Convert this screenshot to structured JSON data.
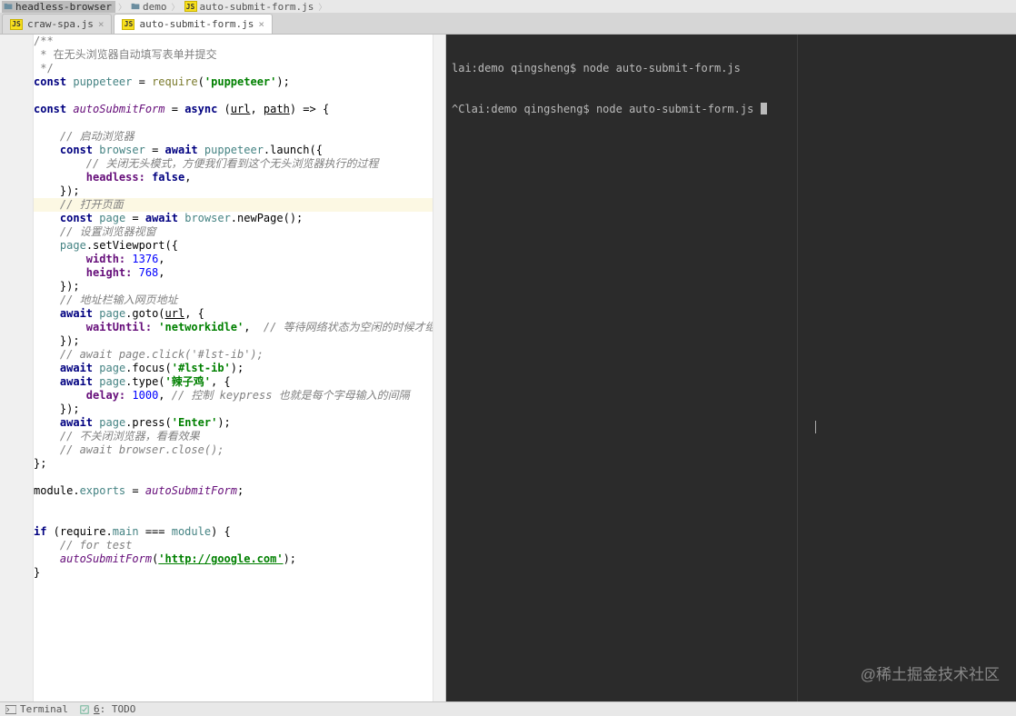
{
  "breadcrumbs": [
    {
      "type": "folder",
      "label": "headless-browser"
    },
    {
      "type": "folder",
      "label": "demo"
    },
    {
      "type": "js",
      "label": "auto-submit-form.js"
    }
  ],
  "tabs": [
    {
      "label": "craw-spa.js",
      "active": false
    },
    {
      "label": "auto-submit-form.js",
      "active": true
    }
  ],
  "highlighted_line_index": 12,
  "code": [
    {
      "t": "doc",
      "s": "/**"
    },
    {
      "t": "doc",
      "s": " * 在无头浏览器自动填写表单并提交"
    },
    {
      "t": "doc",
      "s": " */"
    },
    {
      "t": "raw",
      "tokens": [
        [
          "kw",
          "const"
        ],
        [
          "punc",
          " "
        ],
        [
          "id",
          "puppeteer"
        ],
        [
          "punc",
          " = "
        ],
        [
          "fn",
          "require"
        ],
        [
          "punc",
          "("
        ],
        [
          "str",
          "'puppeteer'"
        ],
        [
          "punc",
          ");"
        ]
      ]
    },
    {
      "t": "blank",
      "s": ""
    },
    {
      "t": "raw",
      "tokens": [
        [
          "kw",
          "const"
        ],
        [
          "punc",
          " "
        ],
        [
          "fi",
          "autoSubmitForm"
        ],
        [
          "punc",
          " = "
        ],
        [
          "kw",
          "async"
        ],
        [
          "punc",
          " ("
        ],
        [
          "em",
          "url"
        ],
        [
          "punc",
          ", "
        ],
        [
          "em",
          "path"
        ],
        [
          "punc",
          ") => {"
        ]
      ]
    },
    {
      "t": "blank",
      "s": ""
    },
    {
      "t": "raw",
      "tokens": [
        [
          "punc",
          "    "
        ],
        [
          "com",
          "// 启动浏览器"
        ]
      ]
    },
    {
      "t": "raw",
      "tokens": [
        [
          "punc",
          "    "
        ],
        [
          "kw",
          "const"
        ],
        [
          "punc",
          " "
        ],
        [
          "id",
          "browser"
        ],
        [
          "punc",
          " = "
        ],
        [
          "kw",
          "await"
        ],
        [
          "punc",
          " "
        ],
        [
          "id",
          "puppeteer"
        ],
        [
          "punc",
          ".launch({"
        ]
      ]
    },
    {
      "t": "raw",
      "tokens": [
        [
          "punc",
          "        "
        ],
        [
          "com",
          "// 关闭无头模式，方便我们看到这个无头浏览器执行的过程"
        ]
      ]
    },
    {
      "t": "raw",
      "tokens": [
        [
          "punc",
          "        "
        ],
        [
          "prop",
          "headless:"
        ],
        [
          "punc",
          " "
        ],
        [
          "kw",
          "false"
        ],
        [
          "punc",
          ","
        ]
      ]
    },
    {
      "t": "raw",
      "tokens": [
        [
          "punc",
          "    });"
        ]
      ]
    },
    {
      "t": "raw",
      "tokens": [
        [
          "punc",
          "    "
        ],
        [
          "com",
          "// 打开页面"
        ]
      ]
    },
    {
      "t": "raw",
      "tokens": [
        [
          "punc",
          "    "
        ],
        [
          "kw",
          "const"
        ],
        [
          "punc",
          " "
        ],
        [
          "id",
          "page"
        ],
        [
          "punc",
          " = "
        ],
        [
          "kw",
          "await"
        ],
        [
          "punc",
          " "
        ],
        [
          "id",
          "browser"
        ],
        [
          "punc",
          ".newPage();"
        ]
      ]
    },
    {
      "t": "raw",
      "tokens": [
        [
          "punc",
          "    "
        ],
        [
          "com",
          "// 设置浏览器视窗"
        ]
      ]
    },
    {
      "t": "raw",
      "tokens": [
        [
          "punc",
          "    "
        ],
        [
          "id",
          "page"
        ],
        [
          "punc",
          ".setViewport({"
        ]
      ]
    },
    {
      "t": "raw",
      "tokens": [
        [
          "punc",
          "        "
        ],
        [
          "prop",
          "width:"
        ],
        [
          "punc",
          " "
        ],
        [
          "num",
          "1376"
        ],
        [
          "punc",
          ","
        ]
      ]
    },
    {
      "t": "raw",
      "tokens": [
        [
          "punc",
          "        "
        ],
        [
          "prop",
          "height:"
        ],
        [
          "punc",
          " "
        ],
        [
          "num",
          "768"
        ],
        [
          "punc",
          ","
        ]
      ]
    },
    {
      "t": "raw",
      "tokens": [
        [
          "punc",
          "    });"
        ]
      ]
    },
    {
      "t": "raw",
      "tokens": [
        [
          "punc",
          "    "
        ],
        [
          "com",
          "// 地址栏输入网页地址"
        ]
      ]
    },
    {
      "t": "raw",
      "tokens": [
        [
          "punc",
          "    "
        ],
        [
          "kw",
          "await"
        ],
        [
          "punc",
          " "
        ],
        [
          "id",
          "page"
        ],
        [
          "punc",
          ".goto("
        ],
        [
          "em",
          "url"
        ],
        [
          "punc",
          ", {"
        ]
      ]
    },
    {
      "t": "raw",
      "tokens": [
        [
          "punc",
          "        "
        ],
        [
          "prop",
          "waitUntil:"
        ],
        [
          "punc",
          " "
        ],
        [
          "str",
          "'networkidle'"
        ],
        [
          "punc",
          ",  "
        ],
        [
          "com",
          "// 等待网络状态为空闲的时候才继续执行"
        ]
      ]
    },
    {
      "t": "raw",
      "tokens": [
        [
          "punc",
          "    });"
        ]
      ]
    },
    {
      "t": "raw",
      "tokens": [
        [
          "punc",
          "    "
        ],
        [
          "com",
          "// await page.click('#lst-ib');"
        ]
      ]
    },
    {
      "t": "raw",
      "tokens": [
        [
          "punc",
          "    "
        ],
        [
          "kw",
          "await"
        ],
        [
          "punc",
          " "
        ],
        [
          "id",
          "page"
        ],
        [
          "punc",
          ".focus("
        ],
        [
          "str",
          "'#lst-ib'"
        ],
        [
          "punc",
          ");"
        ]
      ]
    },
    {
      "t": "raw",
      "tokens": [
        [
          "punc",
          "    "
        ],
        [
          "kw",
          "await"
        ],
        [
          "punc",
          " "
        ],
        [
          "id",
          "page"
        ],
        [
          "punc",
          ".type("
        ],
        [
          "str",
          "'辣子鸡'"
        ],
        [
          "punc",
          ", {"
        ]
      ]
    },
    {
      "t": "raw",
      "tokens": [
        [
          "punc",
          "        "
        ],
        [
          "prop",
          "delay:"
        ],
        [
          "punc",
          " "
        ],
        [
          "num",
          "1000"
        ],
        [
          "punc",
          ", "
        ],
        [
          "com",
          "// 控制 "
        ],
        [
          "docit",
          "keypress"
        ],
        [
          "com",
          " 也就是每个字母输入的间隔"
        ]
      ]
    },
    {
      "t": "raw",
      "tokens": [
        [
          "punc",
          "    });"
        ]
      ]
    },
    {
      "t": "raw",
      "tokens": [
        [
          "punc",
          "    "
        ],
        [
          "kw",
          "await"
        ],
        [
          "punc",
          " "
        ],
        [
          "id",
          "page"
        ],
        [
          "punc",
          ".press("
        ],
        [
          "str",
          "'Enter'"
        ],
        [
          "punc",
          ");"
        ]
      ]
    },
    {
      "t": "raw",
      "tokens": [
        [
          "punc",
          "    "
        ],
        [
          "com",
          "// 不关闭浏览器，看看效果"
        ]
      ]
    },
    {
      "t": "raw",
      "tokens": [
        [
          "punc",
          "    "
        ],
        [
          "com",
          "// await browser.close();"
        ]
      ]
    },
    {
      "t": "raw",
      "tokens": [
        [
          "punc",
          "};"
        ]
      ]
    },
    {
      "t": "blank",
      "s": ""
    },
    {
      "t": "raw",
      "tokens": [
        [
          "punc",
          "module."
        ],
        [
          "id",
          "exports"
        ],
        [
          "punc",
          " = "
        ],
        [
          "fi",
          "autoSubmitForm"
        ],
        [
          "punc",
          ";"
        ]
      ]
    },
    {
      "t": "blank",
      "s": ""
    },
    {
      "t": "blank",
      "s": ""
    },
    {
      "t": "raw",
      "tokens": [
        [
          "kw",
          "if"
        ],
        [
          "punc",
          " (require."
        ],
        [
          "id",
          "main"
        ],
        [
          "punc",
          " === "
        ],
        [
          "id",
          "module"
        ],
        [
          "punc",
          ") {"
        ]
      ]
    },
    {
      "t": "raw",
      "tokens": [
        [
          "punc",
          "    "
        ],
        [
          "com",
          "// for test"
        ]
      ]
    },
    {
      "t": "raw",
      "tokens": [
        [
          "punc",
          "    "
        ],
        [
          "fi",
          "autoSubmitForm"
        ],
        [
          "punc",
          "("
        ],
        [
          "str-url",
          "'http://google.com'"
        ],
        [
          "punc",
          ");"
        ]
      ]
    },
    {
      "t": "raw",
      "tokens": [
        [
          "punc",
          "}"
        ]
      ]
    }
  ],
  "terminal": [
    "lai:demo qingsheng$ node auto-submit-form.js",
    "^Clai:demo qingsheng$ node auto-submit-form.js "
  ],
  "bottom_tabs": {
    "terminal": "Terminal",
    "todo": "6: TODO"
  },
  "watermark": "@稀土掘金技术社区"
}
